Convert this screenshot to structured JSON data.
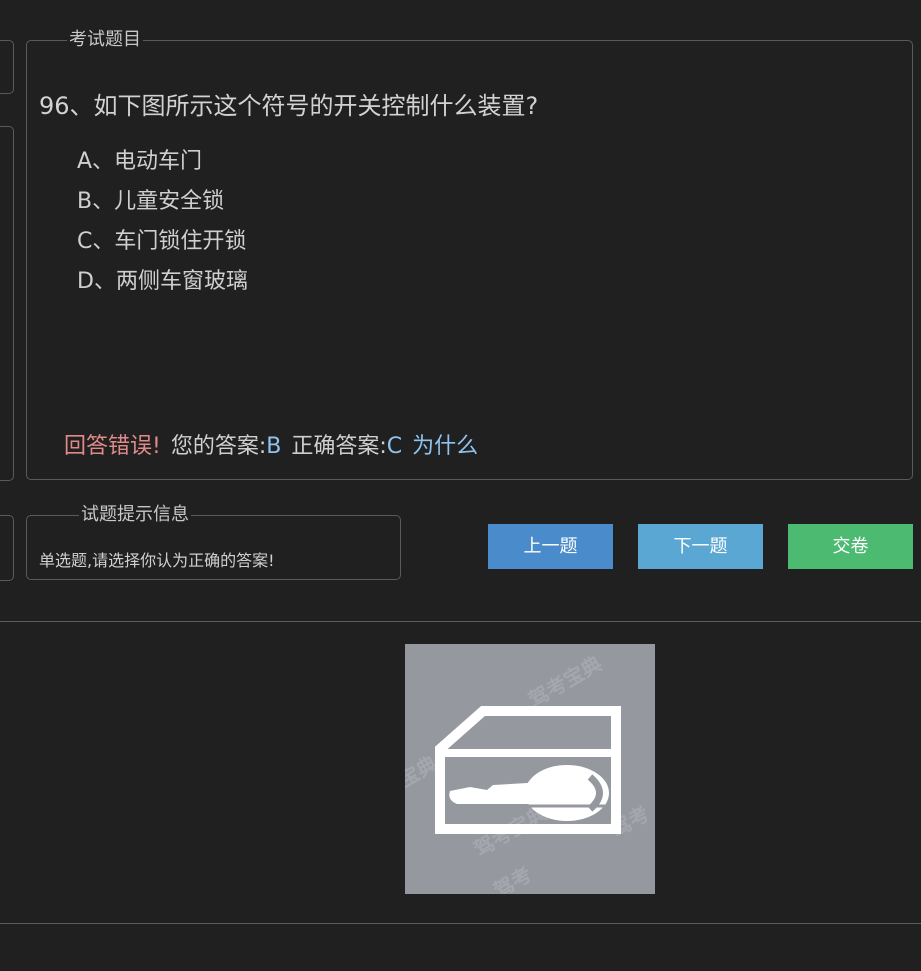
{
  "question_panel": {
    "legend": "考试题目",
    "question": "96、如下图所示这个符号的开关控制什么装置?",
    "options": [
      "A、电动车门",
      "B、儿童安全锁",
      "C、车门锁住开锁",
      "D、两侧车窗玻璃"
    ],
    "result": {
      "status": "回答错误!",
      "your_answer_label": "您的答案:",
      "your_answer": "B",
      "correct_answer_label": "正确答案:",
      "correct_answer": "C",
      "why_link": "为什么"
    }
  },
  "hint_panel": {
    "legend": "试题提示信息",
    "text": "单选题,请选择你认为正确的答案!"
  },
  "buttons": {
    "prev": "上一题",
    "next": "下一题",
    "submit": "交卷"
  },
  "image": {
    "icon": "door-lock-key-icon",
    "watermark": "驾考宝典"
  },
  "colors": {
    "background": "#202020",
    "prev_button": "#4a8bcc",
    "next_button": "#5ba7d3",
    "submit_button": "#4dba72",
    "wrong_text": "#e08a8a",
    "answer_text": "#8fc3ef",
    "image_bg": "#95989f"
  }
}
